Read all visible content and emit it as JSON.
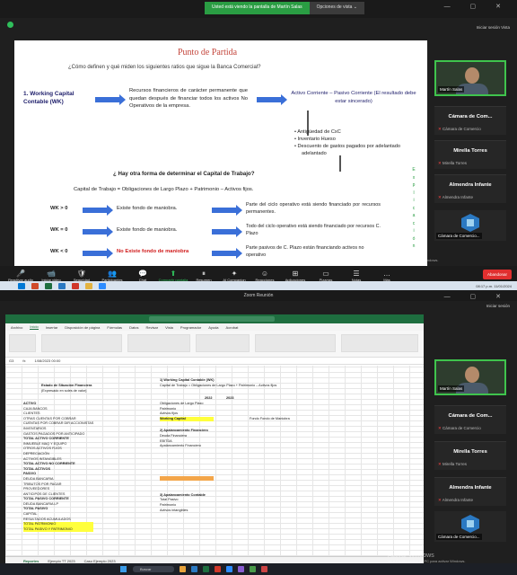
{
  "top": {
    "share_banner": "Usted está viendo la pantalla de Martín Salas",
    "view_options": "Opciones de vista ⌄",
    "top_links": "Iniciar sesión  Vista",
    "slide": {
      "title": "Punto de Partida",
      "question": "¿Cómo definen y qué miden los siguientes ratios que sigue la Banca Comercial?",
      "wk_label": "1. Working Capital Contable (WK)",
      "resources": "Recursos financieros de carácter permanente que quedan después de financiar todos los activos No Operativos de la empresa.",
      "formula_box": "Activo Corriente – Pasivo Corriente (El resultado debe estar sincerado)",
      "bullets": [
        "Antigüedad de CxC",
        "Inventario Hueso",
        "Descuento de gastos pagados por adelantado"
      ],
      "vertical_text": [
        "E",
        "x",
        "p",
        "l",
        "i",
        "c",
        "a",
        "c",
        "i",
        "ó",
        "n"
      ],
      "question2": "¿ Hay otra forma de determinar el Capital de Trabajo?",
      "formula2": "Capital de Trabajo = Obligaciones de Largo Plazo + Patrimonio – Activos fijos.",
      "rows": [
        {
          "label": "WK > 0",
          "middle": "Existe fondo de maniobra.",
          "right": "Parte del ciclo operativo está siendo financiado por recursos permanentes."
        },
        {
          "label": "WK = 0",
          "middle": "Existe fondo de maniobra.",
          "right": "Todo del ciclo operativo está siendo financiado por recursos C. Plazo"
        },
        {
          "label": "WK < 0",
          "middle": "No Existe fondo de maniobra",
          "right": "Parte pasivos de C. Plazo están financiando activos no operativo"
        }
      ]
    },
    "participants": {
      "video_name": "Martín Salas",
      "tiles": [
        {
          "big": "Cámara de Com...",
          "small": "Cámara de Comercio"
        },
        {
          "big": "Mirella Torres",
          "small": "Mirella Torres"
        },
        {
          "big": "Almendra Infante",
          "small": "Almendra Infante"
        }
      ],
      "logo_caption": "Cámara de Comercio..."
    },
    "toolbar": [
      {
        "icon": "🎤",
        "label": "Reactivar audio"
      },
      {
        "icon": "📹",
        "label": "Iniciar video"
      },
      {
        "icon": "🛡",
        "label": "Seguridad"
      },
      {
        "icon": "👥",
        "label": "Participantes"
      },
      {
        "icon": "💬",
        "label": "Chat"
      },
      {
        "icon": "⬆",
        "label": "Compartir pantalla"
      },
      {
        "icon": "⏸",
        "label": "Resumen"
      },
      {
        "icon": "✦",
        "label": "AI Companion"
      },
      {
        "icon": "☺",
        "label": "Reacciones"
      },
      {
        "icon": "⊞",
        "label": "Aplicaciones"
      },
      {
        "icon": "▭",
        "label": "Pizarras"
      },
      {
        "icon": "☰",
        "label": "Notas"
      },
      {
        "icon": "…",
        "label": "Más"
      }
    ],
    "finish_button": "Abandonar",
    "watermark_title": "Activar Windows",
    "watermark_sub": "Ve a Configuración de PC para activar Windows.",
    "clock": "08:17 p.m. 11/01/2024"
  },
  "bottom": {
    "window_title": "Zoom Reunión",
    "top_links": "Iniciar sesión",
    "excel": {
      "file_title": "PLANTILLA 2023 - Excel",
      "menu": [
        "Archivo",
        "Inicio",
        "Insertar",
        "Disposición de página",
        "Fórmulas",
        "Datos",
        "Revisar",
        "Vista",
        "Programador",
        "Ayuda",
        "Acrobat"
      ],
      "cell_ref": "G3",
      "formula_value": "1/08/2023 00:00",
      "sheet_title": "Estado de Situación Financiera",
      "sheet_sub": "(Expresado en soles de valor)",
      "left_rows": [
        "ACTIVO",
        "CAJA BANCOS",
        "CLIENTES",
        "OTRAS CUENTAS POR COBRAR",
        "CUENTAS POR COBRAR DIR ACCIONISTAS",
        "INVENTARIOS",
        "GASTOS PAGADOS POR ANTICIPADO",
        "TOTAL ACTIVO CORRIENTE",
        "INMUEBLE MAQ Y EQUIPO",
        "OTROS ACTIVOS FIJOS",
        "DEPRECIACIÓN",
        "ACTIVOS INTANGIBLES",
        "TOTAL ACTIVO NO CORRIENTE",
        "TOTAL ACTIVOS",
        "PASIVO",
        "DEUDA BANCARIA",
        "TRIBUTOS POR PAGAR",
        "PROVEEDORES",
        "ANTICIPOS DE CLIENTES",
        "TOTAL PASIVO CORRIENTE",
        "DEUDA BANCARIA LP",
        "TOTAL PASIVO",
        "CAPITAL",
        "RESULTADOS ACUMULADOS",
        "TOTAL PATRIMONIO",
        "TOTAL PASIVO Y PATRIMONIO"
      ],
      "right_heading": "1) Working Capital Contable (WK)",
      "right_formula": "Capital de Trabajo = Obligaciones de Largo Plazo + Patrimonio – Activos fijos",
      "right_labels": [
        "Obligaciones de Largo Plazo",
        "Patrimonio",
        "Activos fijos",
        "Working Capital",
        "2) Apalancamiento Financiero",
        "Deuda Financiera",
        "EBITDA",
        "Apalancamiento Financiero",
        "3) Apalancamiento Contable",
        "Total Pasivo",
        "Patrimonio",
        "Activos intangibles"
      ],
      "years": [
        "2022",
        "2023"
      ],
      "note_label": "Fondo Fondo de Maniobra",
      "sheet_tabs": [
        "Reportes",
        "Ejemplo TT 2023",
        "Caso Ejemplo 2023"
      ]
    },
    "participants": {
      "video_name": "Martín Salas",
      "tiles": [
        {
          "big": "Cámara de Com...",
          "small": "Cámara de Comercio"
        },
        {
          "big": "Mirella Torres",
          "small": "Mirella Torres"
        },
        {
          "big": "Almendra Infante",
          "small": "Almendra Infante"
        }
      ],
      "logo_caption": "Cámara de Comercio..."
    },
    "search_placeholder": "Buscar",
    "watermark_title": "Activar Windows",
    "watermark_sub": "Ve a Configuración de PC para activar Windows."
  }
}
